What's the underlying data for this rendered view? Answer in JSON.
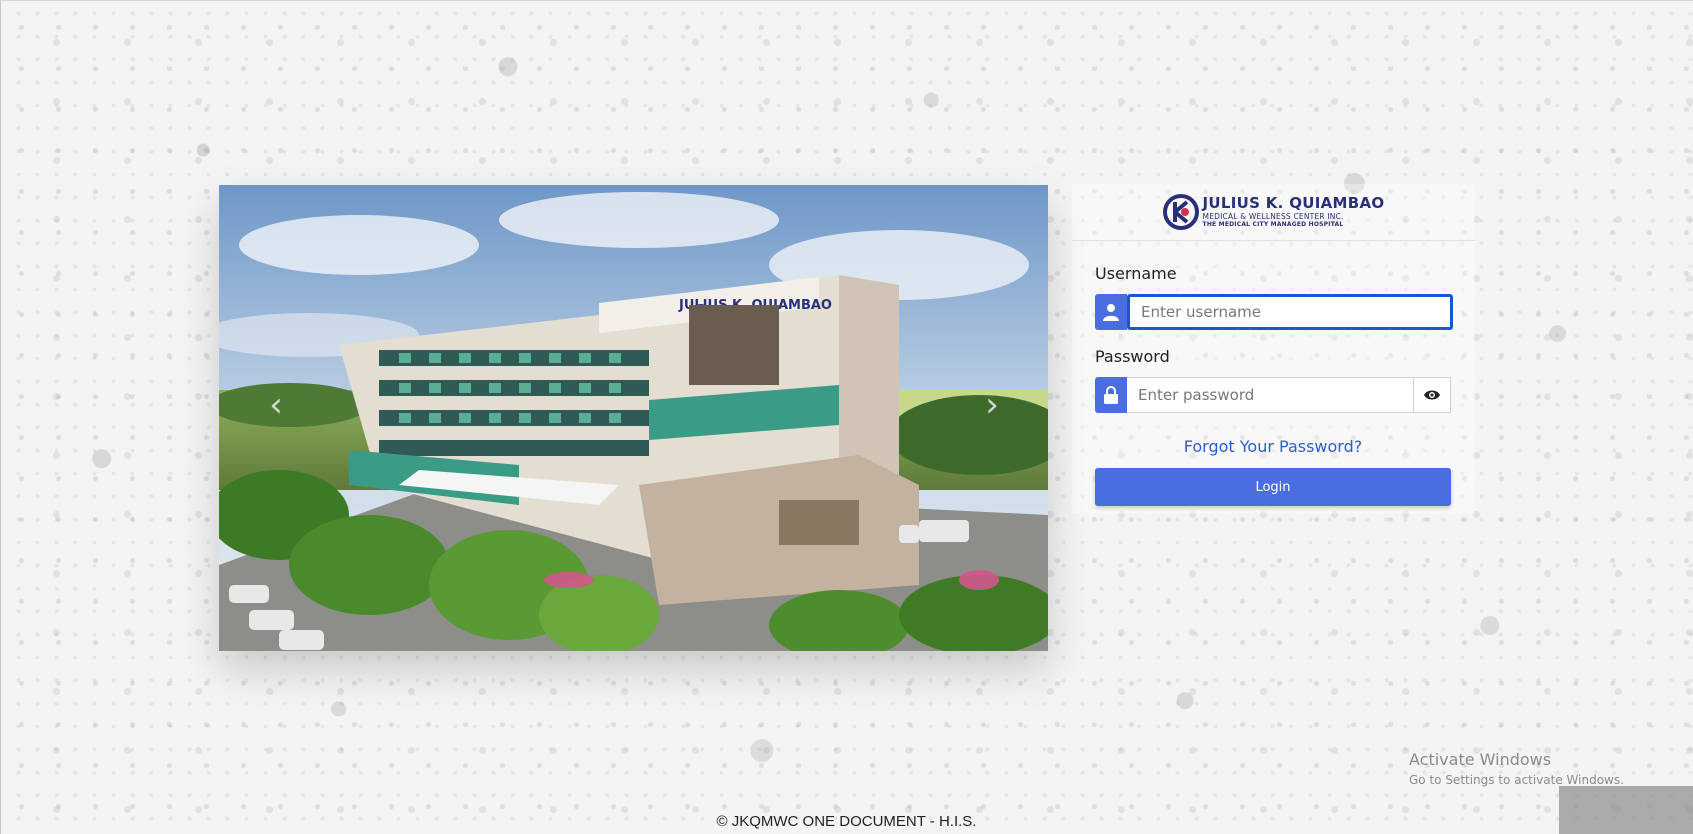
{
  "carousel": {
    "building_sign": "JULIUS K. QUIAMBAO",
    "prev_arrow": "‹",
    "next_arrow": "›"
  },
  "logo": {
    "line1": "JULIUS K. QUIAMBAO",
    "line2": "MEDICAL & WELLNESS CENTER INC.",
    "line3": "THE MEDICAL CITY MANAGED HOSPITAL"
  },
  "login": {
    "username_label": "Username",
    "username_placeholder": "Enter username",
    "username_value": "",
    "password_label": "Password",
    "password_placeholder": "Enter password",
    "password_value": "",
    "forgot_link": "Forgot Your Password?",
    "login_button": "Login"
  },
  "icons": {
    "user": "user-icon",
    "lock": "lock-icon",
    "eye": "eye-icon"
  },
  "colors": {
    "accent": "#4a6ee0",
    "link": "#2b5bd8",
    "focus_border": "#1a56d6",
    "logo_navy": "#2a2f7a"
  },
  "watermark": {
    "title": "Activate Windows",
    "subtitle": "Go to Settings to activate Windows."
  },
  "footer": {
    "text": "© JKQMWC ONE DOCUMENT - H.I.S."
  }
}
